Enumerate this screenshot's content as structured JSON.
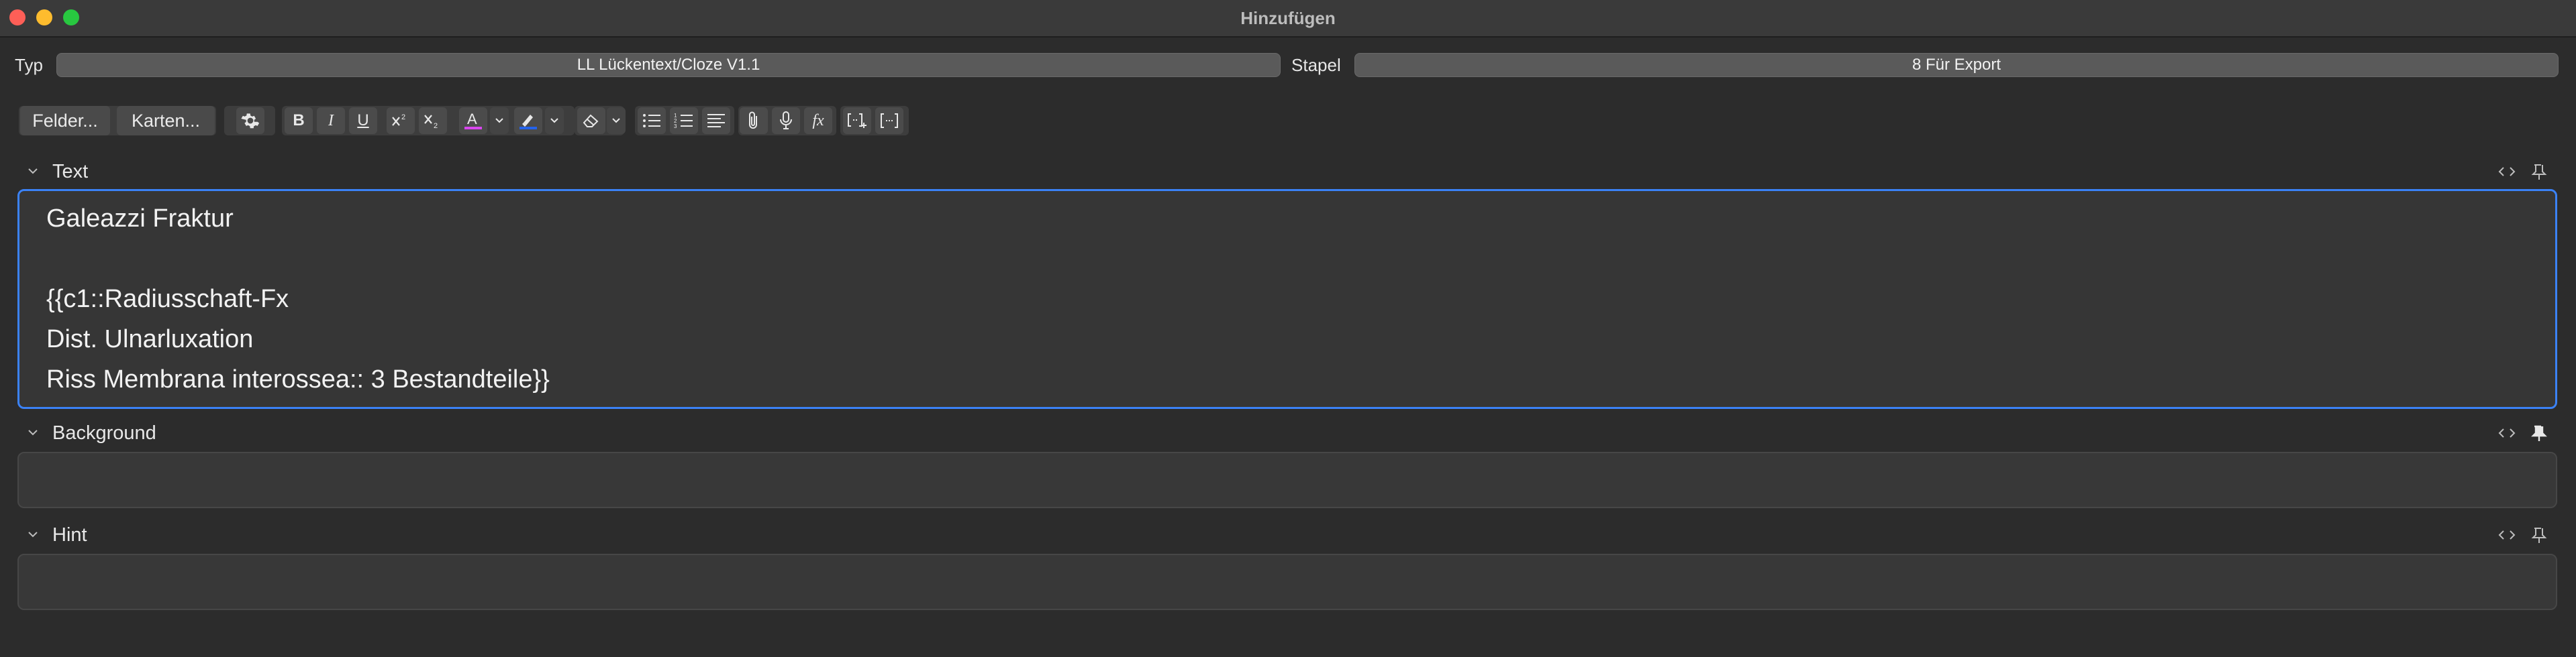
{
  "window": {
    "title": "Hinzufügen"
  },
  "note_type": {
    "label": "Typ",
    "value": "LL Lückentext/Cloze V1.1"
  },
  "deck": {
    "label": "Stapel",
    "value": "8 Für Export"
  },
  "toolbar": {
    "fields_button": "Felder...",
    "cards_button": "Karten...",
    "icons": [
      "gear-icon",
      "bold-icon",
      "italic-icon",
      "underline-icon",
      "superscript-icon",
      "subscript-icon",
      "text-color-icon",
      "chevron-down-icon",
      "highlight-icon",
      "chevron-down-icon",
      "eraser-icon",
      "chevron-down-icon",
      "bullet-list-icon",
      "numbered-list-icon",
      "align-icon",
      "paperclip-icon",
      "microphone-icon",
      "function-icon",
      "cloze-icon",
      "cloze-same-icon"
    ],
    "bold": "B",
    "italic": "I",
    "underline": "U",
    "text_color_glyph": "A",
    "mathjax_glyph": "fx",
    "colors": {
      "text_color_bar": "#d946ef",
      "highlight_bar": "#2563eb",
      "focus_border": "#3b82f6"
    }
  },
  "fields": [
    {
      "name": "Text",
      "lines": [
        "Galeazzi Fraktur",
        "",
        "{{c1::Radiusschaft-Fx",
        "Dist. Ulnarluxation",
        "Riss Membrana interossea:: 3 Bestandteile}}"
      ]
    },
    {
      "name": "Background"
    },
    {
      "name": "Hint"
    }
  ]
}
